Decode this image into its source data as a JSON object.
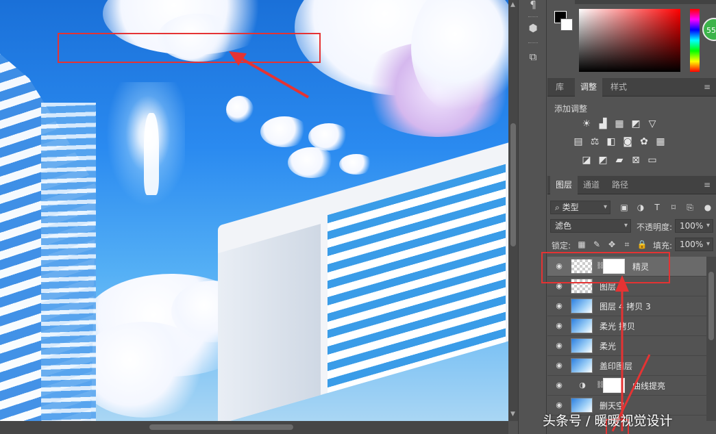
{
  "canvas": {
    "description_icon": "image-canvas"
  },
  "color_panel": {
    "fg_color": "#000000",
    "bg_color": "#ffffff",
    "badge_text": "55"
  },
  "adjust_panel": {
    "tabs": [
      {
        "label": "库",
        "active": false
      },
      {
        "label": "调整",
        "active": true
      },
      {
        "label": "样式",
        "active": false
      }
    ],
    "title": "添加调整",
    "icons_row1": [
      "brightness-icon",
      "levels-icon",
      "curves-icon",
      "exposure-icon",
      "vibrance-icon"
    ],
    "icons_row2": [
      "hue-saturation-icon",
      "color-balance-icon",
      "black-white-icon",
      "photo-filter-icon",
      "channel-mixer-icon",
      "color-lookup-icon"
    ],
    "icons_row3": [
      "invert-icon",
      "posterize-icon",
      "threshold-icon",
      "selective-color-icon",
      "gradient-map-icon"
    ]
  },
  "layers_panel": {
    "tabs": [
      {
        "label": "图层",
        "active": true
      },
      {
        "label": "通道",
        "active": false
      },
      {
        "label": "路径",
        "active": false
      }
    ],
    "filter": {
      "label": "类型",
      "icon": "search-icon"
    },
    "blend_mode": "滤色",
    "opacity_label": "不透明度:",
    "opacity_value": "100%",
    "lock_label": "锁定:",
    "fill_label": "填充:",
    "fill_value": "100%",
    "layers": [
      {
        "name": "精灵",
        "selected": true,
        "thumb": "checker",
        "mask": true
      },
      {
        "name": "图层",
        "selected": false,
        "thumb": "checker",
        "mask": false
      },
      {
        "name": "图层 4 拷贝 3",
        "selected": false,
        "thumb": "image",
        "mask": false
      },
      {
        "name": "柔光 拷贝",
        "selected": false,
        "thumb": "image",
        "mask": false
      },
      {
        "name": "柔光",
        "selected": false,
        "thumb": "image",
        "mask": false
      },
      {
        "name": "盖印图层",
        "selected": false,
        "thumb": "image",
        "mask": false
      },
      {
        "name": "曲线提亮",
        "selected": false,
        "thumb": "adjustment",
        "mask": true
      },
      {
        "name": "删天空",
        "selected": false,
        "thumb": "image",
        "mask": false
      }
    ]
  },
  "watermark": "头条号 / 暖暖视觉设计",
  "accent_red": "#e53333"
}
